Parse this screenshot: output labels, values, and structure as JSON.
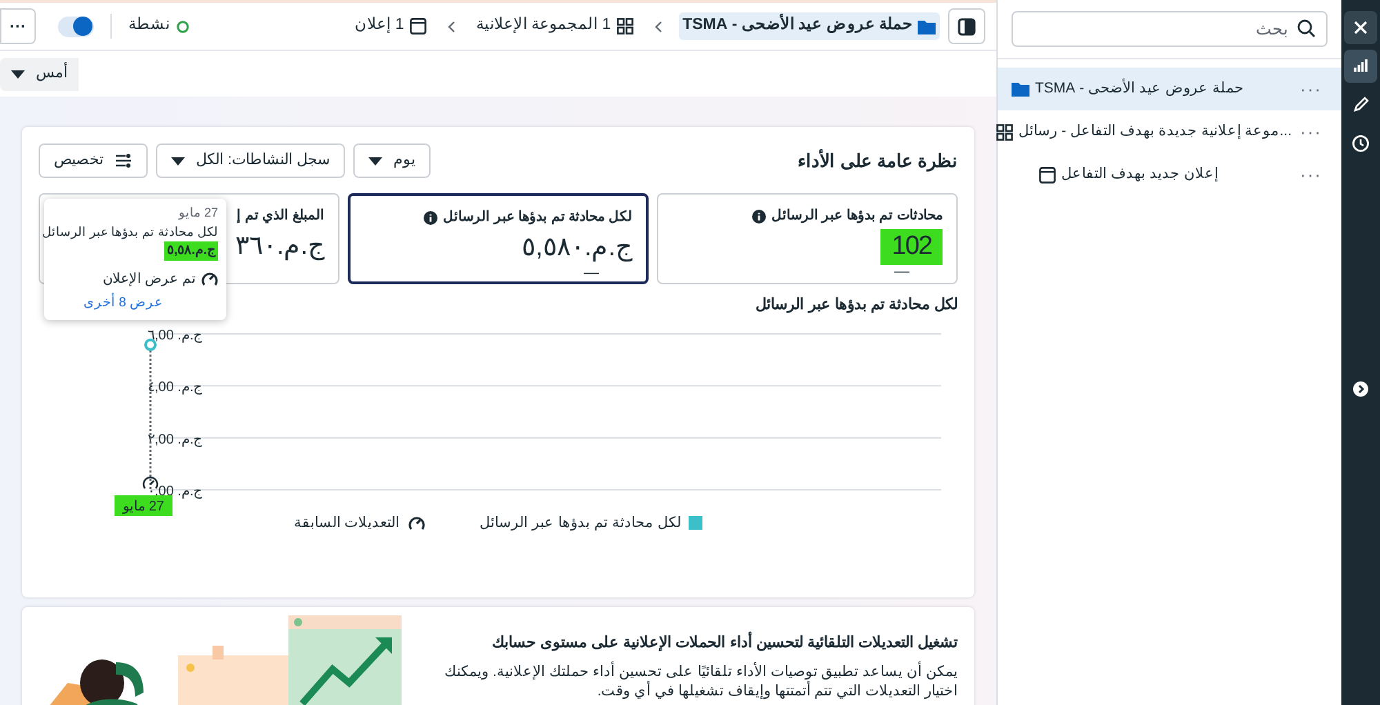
{
  "rail": {
    "items": [
      {
        "kind": "close",
        "selected": false
      },
      {
        "kind": "chart",
        "selected": true
      },
      {
        "kind": "edit",
        "selected": false
      },
      {
        "kind": "history",
        "selected": false
      },
      {
        "kind": "expand",
        "selected": false
      }
    ]
  },
  "sidebar": {
    "search": {
      "placeholder": "بحث"
    },
    "tree": [
      {
        "label": "حملة عروض عيد الأضحى - TSMA",
        "kind": "campaign",
        "selected": true,
        "more": "···",
        "children": [
          {
            "label": "...موعة إعلانية جديدة بهدف التفاعل - رسائل",
            "kind": "adset",
            "selected": false,
            "more": "···",
            "children": [
              {
                "label": "إعلان جديد بهدف التفاعل",
                "kind": "ad",
                "selected": false,
                "more": "···"
              }
            ]
          }
        ]
      }
    ]
  },
  "top_bar": {
    "breadcrumbs": [
      {
        "label": "حملة عروض عيد الأضحى - TSMA",
        "kind": "campaign",
        "selected": true
      },
      {
        "label": "1 المجموعة الإعلانية",
        "kind": "adset",
        "selected": false
      },
      {
        "label": "1 إعلان",
        "kind": "ad",
        "selected": false
      }
    ],
    "status": {
      "label": "نشطة"
    },
    "toggle": {
      "on": true
    },
    "more": "···"
  },
  "date_filter": {
    "value": "أمس"
  },
  "overview": {
    "title": "نظرة عامة على الأداء",
    "controls": [
      {
        "label": "يوم",
        "kind": "dropdown"
      },
      {
        "label": "سجل النشاطات: الكل",
        "kind": "dropdown"
      },
      {
        "label": "تخصيص",
        "kind": "customize"
      }
    ],
    "metrics": [
      {
        "label": "محادثات تم بدؤها عبر الرسائل",
        "info": true,
        "value": "102",
        "highlighted": true,
        "change": "—",
        "selected": false
      },
      {
        "label": "لكل محادثة تم بدؤها عبر الرسائل",
        "info": true,
        "value": "ج.م.٥,٥٨٠",
        "highlighted": false,
        "change": "—",
        "selected": true
      },
      {
        "label": "المبلغ الذي تم إ",
        "info": false,
        "value": "ج.م.٣٦٠",
        "highlighted": false,
        "selected": false
      }
    ],
    "tooltip": {
      "date": "27 مايو",
      "metric": "لكل محادثة تم بدؤها عبر الرسائل",
      "value": "ج.م.٥,٥٨",
      "value_highlighted": true,
      "event": "تم عرض الإعلان",
      "link": "عرض 8 أخرى"
    },
    "chart_title": "لكل محادثة تم بدؤها عبر الرسائل",
    "chart_data": {
      "type": "line",
      "grid": true,
      "categories": [
        "27 مايو"
      ],
      "series": [
        {
          "name": "لكل محادثة تم بدؤها عبر الرسائل",
          "color": "#3cbfc9",
          "marker": "circle",
          "values": [
            5.58
          ]
        }
      ],
      "ylim": [
        0,
        6
      ],
      "ref_lines": [
        {
          "axis": "x",
          "value": "27 مايو"
        }
      ],
      "yticks": [
        {
          "value": 0,
          "label": "ج.م. ٠,00"
        },
        {
          "value": 2,
          "label": "ج.م. ٢,00"
        },
        {
          "value": 4,
          "label": "ج.م. ٤,00"
        },
        {
          "value": 6,
          "label": "ج.م. ٦,00"
        }
      ]
    },
    "date_label_highlighted": true,
    "legend": [
      {
        "kind": "series"
      },
      {
        "label": "التعديلات السابقة",
        "kind": "marker"
      }
    ]
  },
  "promo": {
    "title": "تشغيل التعديلات التلقائية لتحسين أداء الحملات الإعلانية على مستوى حسابك",
    "body": "يمكن أن يساعد تطبيق توصيات الأداء تلقائيًا على تحسين أداء حملتك الإعلانية. ويمكنك اختيار التعديلات التي تتم أتمتتها وإيقاف تشغيلها في أي وقت."
  }
}
